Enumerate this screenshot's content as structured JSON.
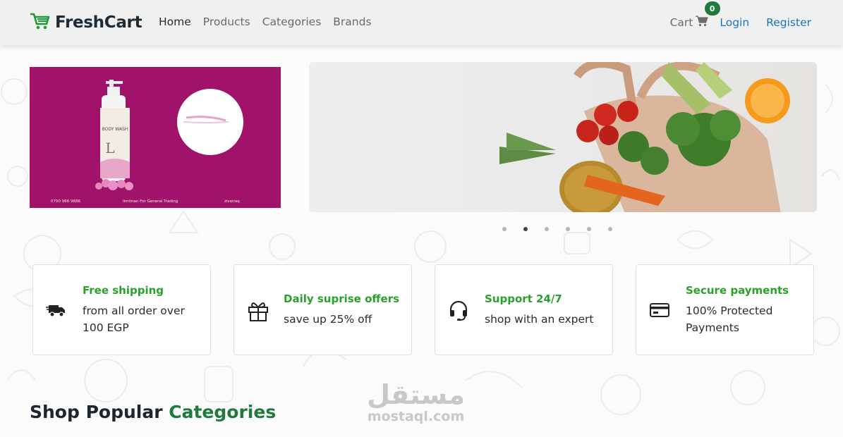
{
  "brand": {
    "name": "FreshCart",
    "accent_color": "#1f9c3a",
    "logo_icon": "shopping-cart-icon"
  },
  "nav": {
    "links": [
      {
        "label": "Home",
        "active": true
      },
      {
        "label": "Products",
        "active": false
      },
      {
        "label": "Categories",
        "active": false
      },
      {
        "label": "Brands",
        "active": false
      }
    ],
    "cart": {
      "label": "Cart",
      "count": "0",
      "icon": "cart-icon"
    },
    "login": "Login",
    "register": "Register"
  },
  "banner_left": {
    "product_lines": [
      "BODY WASH",
      "L"
    ],
    "footer": [
      "0750 966 9686",
      "Iimtinan For General Trading",
      "zivairaq"
    ],
    "background": "#a1136a"
  },
  "slider": {
    "total_slides": 6,
    "active_index": 1
  },
  "features": [
    {
      "title": "Free shipping",
      "desc": "from all order over 100 EGP",
      "icon": "truck-icon"
    },
    {
      "title": "Daily suprise offers",
      "desc": "save up 25% off",
      "icon": "gift-icon"
    },
    {
      "title": "Support 24/7",
      "desc": "shop with an expert",
      "icon": "headset-icon"
    },
    {
      "title": "Secure payments",
      "desc": "100% Protected Payments",
      "icon": "credit-card-icon"
    }
  ],
  "section": {
    "title_prefix": "Shop Popular",
    "title_accent": "Categories"
  },
  "watermark": {
    "arabic": "مستقل",
    "latin": "mostaql.com"
  },
  "colors": {
    "title_green": "#2aa12a",
    "heading_green": "#1f7a3c",
    "link_blue": "#1a73c8",
    "badge_green": "#1f7a3c"
  }
}
